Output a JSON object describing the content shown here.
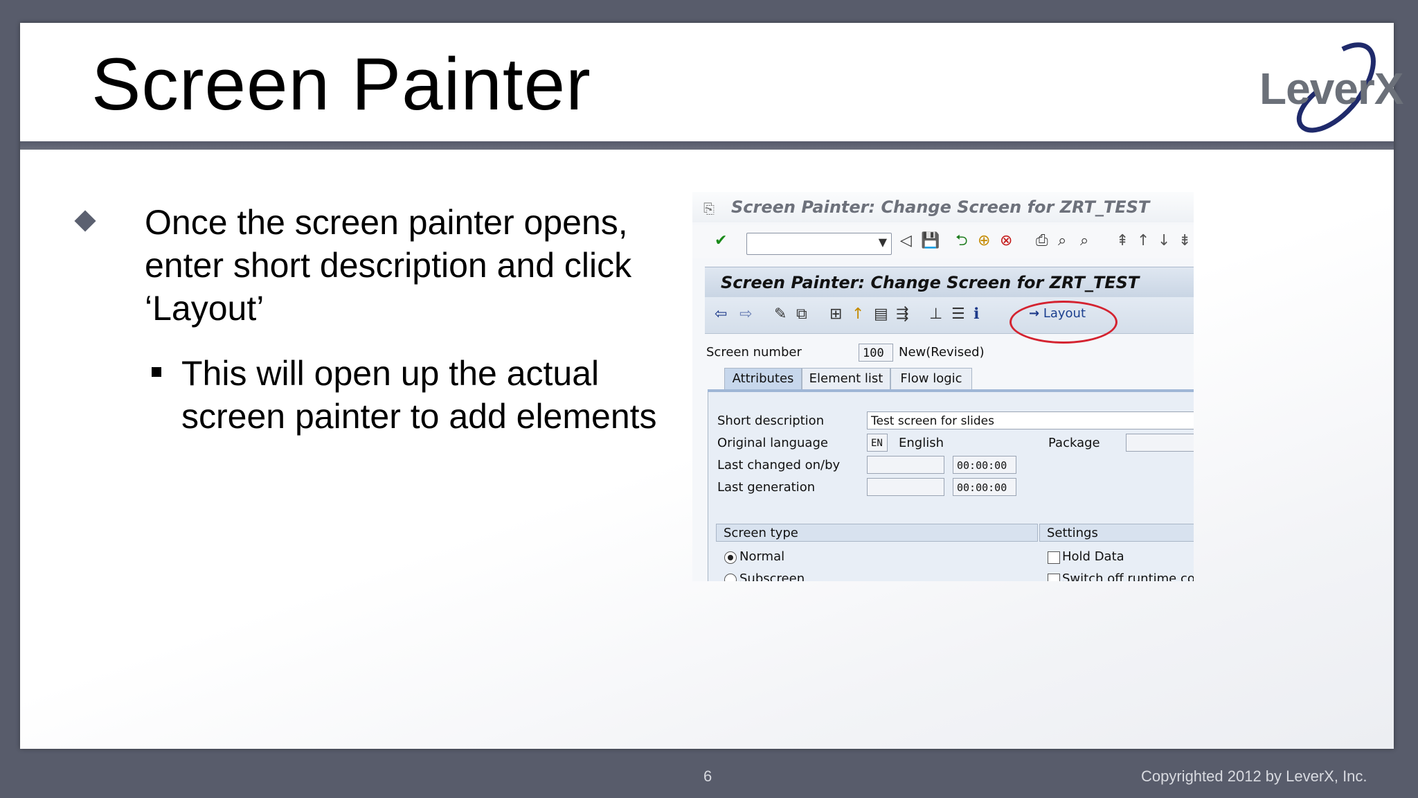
{
  "slide": {
    "title": "Screen Painter",
    "logo_text": "LeverX",
    "bullet1": "Once the screen painter opens, enter short description and click ‘Layout’",
    "bullet2": "This will open up the actual screen painter to add elements",
    "page_number": "6",
    "copyright": "Copyrighted 2012 by LeverX, Inc.",
    "colors": {
      "background": "#585c6b",
      "accent_circle": "#d42330",
      "logo": "#6b7079",
      "logo_swoosh": "#1f2a6b"
    }
  },
  "sap": {
    "window_title": "Screen Painter: Change Screen for ZRT_TEST",
    "screen_title": "Screen Painter: Change Screen for ZRT_TEST",
    "command_field": {
      "value": ""
    },
    "layout_button": "Layout",
    "screen_number_label": "Screen number",
    "screen_number_value": "100",
    "screen_status": "New(Revised)",
    "tabs": [
      {
        "label": "Attributes",
        "active": true
      },
      {
        "label": "Element list",
        "active": false
      },
      {
        "label": "Flow logic",
        "active": false
      }
    ],
    "attributes": {
      "short_description_label": "Short description",
      "short_description_value": "Test screen for slides",
      "original_language_label": "Original language",
      "language_code": "EN",
      "language_name": "English",
      "package_label": "Package",
      "package_value": "",
      "last_changed_label": "Last changed on/by",
      "last_changed_date": "",
      "last_changed_time": "00:00:00",
      "last_generation_label": "Last generation",
      "last_generation_date": "",
      "last_generation_time": "00:00:00"
    },
    "screen_type": {
      "header": "Screen type",
      "options": [
        {
          "label": "Normal",
          "selected": true
        },
        {
          "label": "Subscreen",
          "selected": false
        }
      ]
    },
    "settings": {
      "header": "Settings",
      "options": [
        {
          "label": "Hold Data",
          "checked": false
        },
        {
          "label": "Switch off runtime com",
          "checked": false
        }
      ]
    }
  }
}
